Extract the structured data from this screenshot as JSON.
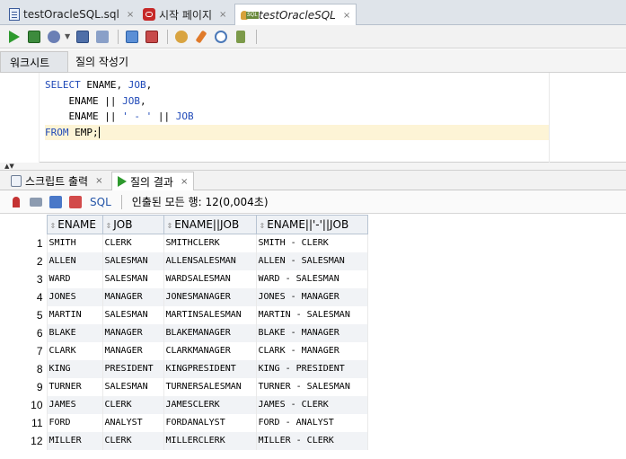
{
  "doc_tabs": [
    {
      "label": "testOracleSQL.sql",
      "icon": "sql-file-icon",
      "active": false
    },
    {
      "label": "시작 페이지",
      "icon": "oracle-icon",
      "active": false
    },
    {
      "label": "testOracleSQL",
      "icon": "sql-worksheet-icon",
      "active": true
    }
  ],
  "close_glyph": "×",
  "worksheet_tabs": {
    "worksheet": "워크시트",
    "query_builder": "질의 작성기"
  },
  "editor": {
    "lines": [
      {
        "parts": [
          {
            "t": "SELECT",
            "k": "kw"
          },
          {
            "t": " ENAME, "
          },
          {
            "t": "JOB",
            "k": "kw"
          },
          {
            "t": ","
          }
        ]
      },
      {
        "parts": [
          {
            "t": "    ENAME || "
          },
          {
            "t": "JOB",
            "k": "kw"
          },
          {
            "t": ","
          }
        ]
      },
      {
        "parts": [
          {
            "t": "    ENAME || "
          },
          {
            "t": "' - '",
            "k": "str"
          },
          {
            "t": " || "
          },
          {
            "t": "JOB",
            "k": "kw"
          }
        ]
      },
      {
        "parts": [
          {
            "t": "FROM",
            "k": "kw"
          },
          {
            "t": " EMP;"
          }
        ],
        "highlight": true,
        "caret": true
      }
    ]
  },
  "result_tabs": [
    {
      "label": "스크립트 출력",
      "icon": "script-output-icon",
      "active": false
    },
    {
      "label": "질의 결과",
      "icon": "run-icon",
      "active": true
    }
  ],
  "results_toolbar": {
    "sql_label": "SQL",
    "status": "인출된 모든 행: 12(0,004초)"
  },
  "grid": {
    "columns": [
      "ENAME",
      "JOB",
      "ENAME||JOB",
      "ENAME||'-'||JOB"
    ],
    "rows": [
      {
        "n": "1",
        "cells": [
          "SMITH",
          "CLERK",
          "SMITHCLERK",
          "SMITH - CLERK"
        ]
      },
      {
        "n": "2",
        "cells": [
          "ALLEN",
          "SALESMAN",
          "ALLENSALESMAN",
          "ALLEN - SALESMAN"
        ]
      },
      {
        "n": "3",
        "cells": [
          "WARD",
          "SALESMAN",
          "WARDSALESMAN",
          "WARD - SALESMAN"
        ]
      },
      {
        "n": "4",
        "cells": [
          "JONES",
          "MANAGER",
          "JONESMANAGER",
          "JONES - MANAGER"
        ]
      },
      {
        "n": "5",
        "cells": [
          "MARTIN",
          "SALESMAN",
          "MARTINSALESMAN",
          "MARTIN - SALESMAN"
        ]
      },
      {
        "n": "6",
        "cells": [
          "BLAKE",
          "MANAGER",
          "BLAKEMANAGER",
          "BLAKE - MANAGER"
        ]
      },
      {
        "n": "7",
        "cells": [
          "CLARK",
          "MANAGER",
          "CLARKMANAGER",
          "CLARK - MANAGER"
        ]
      },
      {
        "n": "8",
        "cells": [
          "KING",
          "PRESIDENT",
          "KINGPRESIDENT",
          "KING - PRESIDENT"
        ]
      },
      {
        "n": "9",
        "cells": [
          "TURNER",
          "SALESMAN",
          "TURNERSALESMAN",
          "TURNER - SALESMAN"
        ]
      },
      {
        "n": "10",
        "cells": [
          "JAMES",
          "CLERK",
          "JAMESCLERK",
          "JAMES - CLERK"
        ]
      },
      {
        "n": "11",
        "cells": [
          "FORD",
          "ANALYST",
          "FORDANALYST",
          "FORD - ANALYST"
        ]
      },
      {
        "n": "12",
        "cells": [
          "MILLER",
          "CLERK",
          "MILLERCLERK",
          "MILLER - CLERK"
        ]
      }
    ]
  },
  "colors": {
    "keyword": "#1f49b8",
    "current_line": "#fdf4d6",
    "run_green": "#2e9a2e",
    "link_blue": "#2455a8"
  }
}
